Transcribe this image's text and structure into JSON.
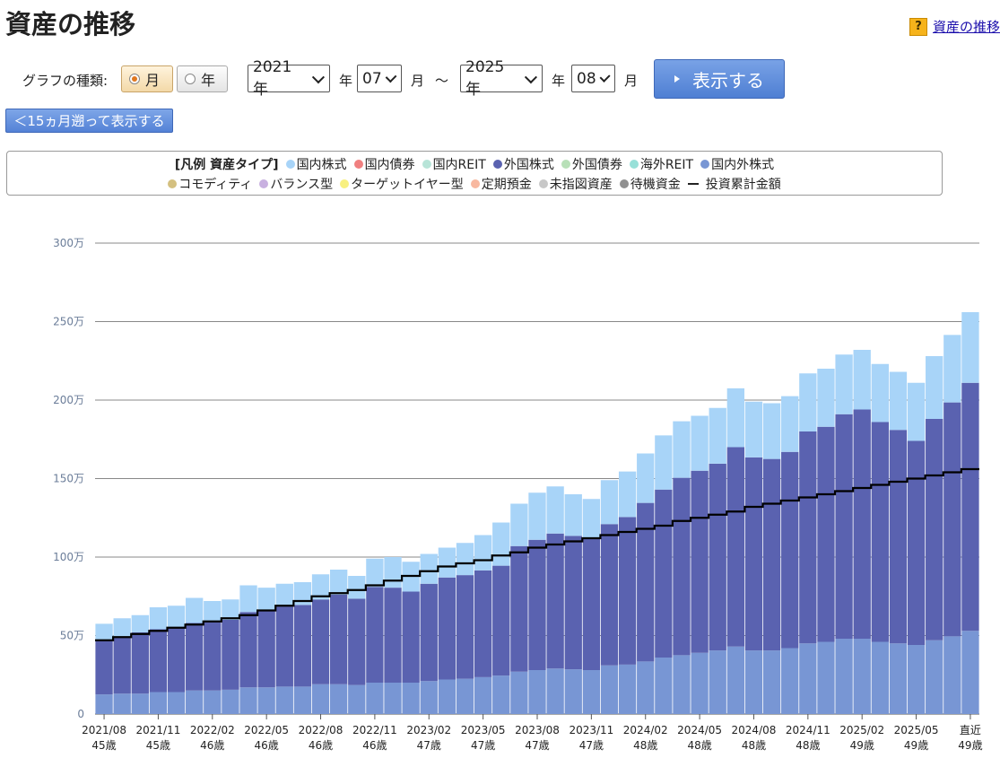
{
  "page": {
    "title": "資産の推移",
    "help_link": "資産の推移",
    "help_icon": "question-icon"
  },
  "controls": {
    "graph_type_label": "グラフの種類:",
    "month_option": "月",
    "year_option": "年",
    "selected_type": "月",
    "start_year": "2021 年",
    "start_month": "07",
    "end_year": "2025 年",
    "end_month": "08",
    "year_unit": "年",
    "month_unit": "月",
    "tilde": "～",
    "show_button": "表示する",
    "back_button": "＜15ヵ月遡って表示する"
  },
  "legend": {
    "heading": "[凡例 資産タイプ]",
    "row1": [
      {
        "label": "国内株式",
        "color": "#a8d4f8"
      },
      {
        "label": "国内債券",
        "color": "#f08080"
      },
      {
        "label": "国内REIT",
        "color": "#b8e4d8"
      },
      {
        "label": "外国株式",
        "color": "#5a62b0"
      },
      {
        "label": "外国債券",
        "color": "#b8e0b8"
      },
      {
        "label": "海外REIT",
        "color": "#98e0d8"
      },
      {
        "label": "国内外株式",
        "color": "#7896d4"
      }
    ],
    "row2": [
      {
        "label": "コモディティ",
        "color": "#d4c080"
      },
      {
        "label": "バランス型",
        "color": "#c8b0e0"
      },
      {
        "label": "ターゲットイヤー型",
        "color": "#f8f080"
      },
      {
        "label": "定期預金",
        "color": "#f8b8a0"
      },
      {
        "label": "未指図資産",
        "color": "#c8c8c8"
      },
      {
        "label": "待機資金",
        "color": "#909090"
      }
    ],
    "line_label": "投資累計金額"
  },
  "chart_data": {
    "type": "bar",
    "stacked": true,
    "ylim": [
      0,
      3000000
    ],
    "yticks": [
      0,
      500000,
      1000000,
      1500000,
      2000000,
      2500000,
      3000000
    ],
    "ytick_labels": [
      "0",
      "50万",
      "100万",
      "150万",
      "200万",
      "250万",
      "300万"
    ],
    "grid": true,
    "categories": [
      "2021/08",
      "2021/09",
      "2021/10",
      "2021/11",
      "2021/12",
      "2022/01",
      "2022/02",
      "2022/03",
      "2022/04",
      "2022/05",
      "2022/06",
      "2022/07",
      "2022/08",
      "2022/09",
      "2022/10",
      "2022/11",
      "2022/12",
      "2023/01",
      "2023/02",
      "2023/03",
      "2023/04",
      "2023/05",
      "2023/06",
      "2023/07",
      "2023/08",
      "2023/09",
      "2023/10",
      "2023/11",
      "2023/12",
      "2024/01",
      "2024/02",
      "2024/03",
      "2024/04",
      "2024/05",
      "2024/06",
      "2024/07",
      "2024/08",
      "2024/09",
      "2024/10",
      "2024/11",
      "2024/12",
      "2025/01",
      "2025/02",
      "2025/03",
      "2025/04",
      "2025/05",
      "2025/06",
      "2025/07",
      "直近"
    ],
    "x_tick_labels": [
      {
        "index": 0,
        "date": "2021/08",
        "age": "45歳"
      },
      {
        "index": 3,
        "date": "2021/11",
        "age": "45歳"
      },
      {
        "index": 6,
        "date": "2022/02",
        "age": "46歳"
      },
      {
        "index": 9,
        "date": "2022/05",
        "age": "46歳"
      },
      {
        "index": 12,
        "date": "2022/08",
        "age": "46歳"
      },
      {
        "index": 15,
        "date": "2022/11",
        "age": "46歳"
      },
      {
        "index": 18,
        "date": "2023/02",
        "age": "47歳"
      },
      {
        "index": 21,
        "date": "2023/05",
        "age": "47歳"
      },
      {
        "index": 24,
        "date": "2023/08",
        "age": "47歳"
      },
      {
        "index": 27,
        "date": "2023/11",
        "age": "47歳"
      },
      {
        "index": 30,
        "date": "2024/02",
        "age": "48歳"
      },
      {
        "index": 33,
        "date": "2024/05",
        "age": "48歳"
      },
      {
        "index": 36,
        "date": "2024/08",
        "age": "48歳"
      },
      {
        "index": 39,
        "date": "2024/11",
        "age": "48歳"
      },
      {
        "index": 42,
        "date": "2025/02",
        "age": "49歳"
      },
      {
        "index": 45,
        "date": "2025/05",
        "age": "49歳"
      },
      {
        "index": 48,
        "date": "直近",
        "age": "49歳"
      }
    ],
    "series": [
      {
        "name": "国内外株式",
        "color": "#7896d4",
        "values": [
          125000,
          130000,
          130000,
          140000,
          140000,
          150000,
          150000,
          155000,
          170000,
          170000,
          175000,
          175000,
          190000,
          190000,
          185000,
          200000,
          200000,
          200000,
          210000,
          220000,
          225000,
          235000,
          245000,
          270000,
          280000,
          290000,
          285000,
          280000,
          310000,
          315000,
          335000,
          360000,
          375000,
          390000,
          405000,
          430000,
          405000,
          405000,
          420000,
          450000,
          460000,
          480000,
          480000,
          460000,
          450000,
          440000,
          470000,
          495000,
          530000,
          545000
        ]
      },
      {
        "name": "外国株式",
        "color": "#5a62b0",
        "values": [
          345000,
          360000,
          390000,
          400000,
          410000,
          430000,
          440000,
          445000,
          480000,
          485000,
          510000,
          520000,
          540000,
          570000,
          550000,
          610000,
          605000,
          580000,
          620000,
          650000,
          660000,
          680000,
          700000,
          800000,
          830000,
          860000,
          850000,
          840000,
          900000,
          940000,
          1010000,
          1070000,
          1130000,
          1160000,
          1190000,
          1270000,
          1230000,
          1220000,
          1250000,
          1350000,
          1370000,
          1430000,
          1460000,
          1400000,
          1360000,
          1300000,
          1410000,
          1490000,
          1580000,
          1610000
        ]
      },
      {
        "name": "国内株式",
        "color": "#a8d4f8",
        "values": [
          105000,
          120000,
          110000,
          140000,
          140000,
          160000,
          130000,
          130000,
          170000,
          150000,
          145000,
          145000,
          160000,
          160000,
          145000,
          180000,
          195000,
          190000,
          190000,
          190000,
          205000,
          225000,
          275000,
          270000,
          300000,
          300000,
          265000,
          250000,
          280000,
          290000,
          315000,
          345000,
          360000,
          350000,
          355000,
          375000,
          355000,
          355000,
          355000,
          370000,
          370000,
          380000,
          380000,
          370000,
          370000,
          370000,
          400000,
          430000,
          450000,
          440000
        ]
      }
    ],
    "line": {
      "name": "投資累計金額",
      "values": [
        470000,
        490000,
        510000,
        530000,
        550000,
        570000,
        590000,
        610000,
        630000,
        660000,
        690000,
        720000,
        750000,
        770000,
        790000,
        820000,
        850000,
        880000,
        910000,
        940000,
        960000,
        980000,
        1010000,
        1030000,
        1060000,
        1080000,
        1100000,
        1120000,
        1140000,
        1160000,
        1180000,
        1200000,
        1230000,
        1250000,
        1270000,
        1290000,
        1320000,
        1340000,
        1360000,
        1380000,
        1400000,
        1420000,
        1440000,
        1460000,
        1480000,
        1500000,
        1520000,
        1540000,
        1560000,
        1600000
      ]
    }
  }
}
